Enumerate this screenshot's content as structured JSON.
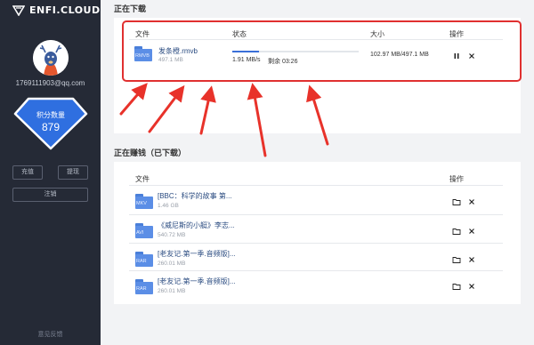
{
  "app": {
    "logo_text": "ENFI.CLOUD"
  },
  "sidebar": {
    "email": "1769111903@qq.com",
    "points_label": "积分数量",
    "points_value": "879",
    "recharge_label": "充值",
    "withdraw_label": "提现",
    "logout_label": "注销",
    "feedback_label": "意见反馈"
  },
  "downloading": {
    "title": "正在下载",
    "headers": {
      "file": "文件",
      "status": "状态",
      "size": "大小",
      "action": "操作"
    },
    "item": {
      "name": "发条橙.rmvb",
      "size": "497.1 MB",
      "ext": "RMVB",
      "progress": 0.21,
      "speed": "1.91 MB/s",
      "remaining": "剩余 03:26",
      "size_progress": "102.97 MB/497.1 MB"
    }
  },
  "earning": {
    "title": "正在赚钱（已下载）",
    "headers": {
      "file": "文件",
      "action": "操作"
    },
    "items": [
      {
        "name": "[BBC：科学的故事 第...",
        "size": "1.46 GB",
        "ext": "MKV"
      },
      {
        "name": "《威尼斯的小艇》李志...",
        "size": "540.72 MB",
        "ext": "AVI"
      },
      {
        "name": "[老友记.第一季.音频版]...",
        "size": "260.01 MB",
        "ext": "RAR"
      },
      {
        "name": "[老友记.第一季.音频版]...",
        "size": "260.01 MB",
        "ext": "RAR"
      }
    ]
  },
  "colors": {
    "sidebar_bg": "#252a36",
    "accent": "#3a6fd8",
    "highlight": "#e03030",
    "diamond": "#2f6fe0"
  }
}
